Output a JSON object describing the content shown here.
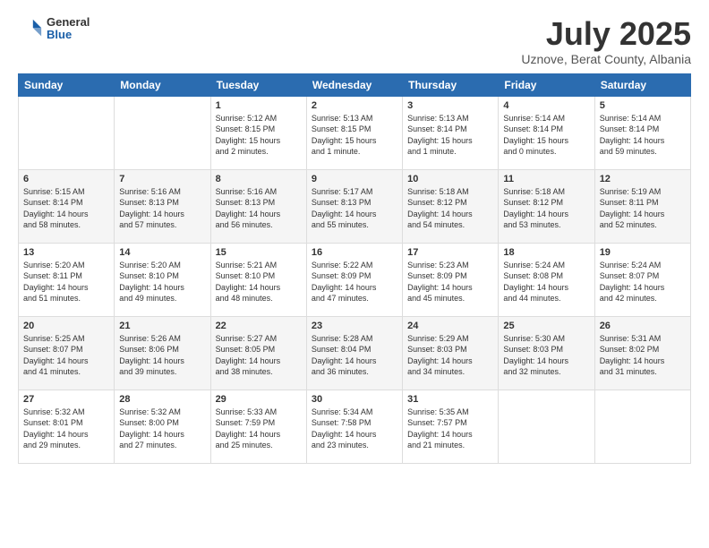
{
  "logo": {
    "general": "General",
    "blue": "Blue"
  },
  "header": {
    "month": "July 2025",
    "location": "Uznove, Berat County, Albania"
  },
  "weekdays": [
    "Sunday",
    "Monday",
    "Tuesday",
    "Wednesday",
    "Thursday",
    "Friday",
    "Saturday"
  ],
  "weeks": [
    [
      {
        "day": "",
        "info": ""
      },
      {
        "day": "",
        "info": ""
      },
      {
        "day": "1",
        "info": "Sunrise: 5:12 AM\nSunset: 8:15 PM\nDaylight: 15 hours\nand 2 minutes."
      },
      {
        "day": "2",
        "info": "Sunrise: 5:13 AM\nSunset: 8:15 PM\nDaylight: 15 hours\nand 1 minute."
      },
      {
        "day": "3",
        "info": "Sunrise: 5:13 AM\nSunset: 8:14 PM\nDaylight: 15 hours\nand 1 minute."
      },
      {
        "day": "4",
        "info": "Sunrise: 5:14 AM\nSunset: 8:14 PM\nDaylight: 15 hours\nand 0 minutes."
      },
      {
        "day": "5",
        "info": "Sunrise: 5:14 AM\nSunset: 8:14 PM\nDaylight: 14 hours\nand 59 minutes."
      }
    ],
    [
      {
        "day": "6",
        "info": "Sunrise: 5:15 AM\nSunset: 8:14 PM\nDaylight: 14 hours\nand 58 minutes."
      },
      {
        "day": "7",
        "info": "Sunrise: 5:16 AM\nSunset: 8:13 PM\nDaylight: 14 hours\nand 57 minutes."
      },
      {
        "day": "8",
        "info": "Sunrise: 5:16 AM\nSunset: 8:13 PM\nDaylight: 14 hours\nand 56 minutes."
      },
      {
        "day": "9",
        "info": "Sunrise: 5:17 AM\nSunset: 8:13 PM\nDaylight: 14 hours\nand 55 minutes."
      },
      {
        "day": "10",
        "info": "Sunrise: 5:18 AM\nSunset: 8:12 PM\nDaylight: 14 hours\nand 54 minutes."
      },
      {
        "day": "11",
        "info": "Sunrise: 5:18 AM\nSunset: 8:12 PM\nDaylight: 14 hours\nand 53 minutes."
      },
      {
        "day": "12",
        "info": "Sunrise: 5:19 AM\nSunset: 8:11 PM\nDaylight: 14 hours\nand 52 minutes."
      }
    ],
    [
      {
        "day": "13",
        "info": "Sunrise: 5:20 AM\nSunset: 8:11 PM\nDaylight: 14 hours\nand 51 minutes."
      },
      {
        "day": "14",
        "info": "Sunrise: 5:20 AM\nSunset: 8:10 PM\nDaylight: 14 hours\nand 49 minutes."
      },
      {
        "day": "15",
        "info": "Sunrise: 5:21 AM\nSunset: 8:10 PM\nDaylight: 14 hours\nand 48 minutes."
      },
      {
        "day": "16",
        "info": "Sunrise: 5:22 AM\nSunset: 8:09 PM\nDaylight: 14 hours\nand 47 minutes."
      },
      {
        "day": "17",
        "info": "Sunrise: 5:23 AM\nSunset: 8:09 PM\nDaylight: 14 hours\nand 45 minutes."
      },
      {
        "day": "18",
        "info": "Sunrise: 5:24 AM\nSunset: 8:08 PM\nDaylight: 14 hours\nand 44 minutes."
      },
      {
        "day": "19",
        "info": "Sunrise: 5:24 AM\nSunset: 8:07 PM\nDaylight: 14 hours\nand 42 minutes."
      }
    ],
    [
      {
        "day": "20",
        "info": "Sunrise: 5:25 AM\nSunset: 8:07 PM\nDaylight: 14 hours\nand 41 minutes."
      },
      {
        "day": "21",
        "info": "Sunrise: 5:26 AM\nSunset: 8:06 PM\nDaylight: 14 hours\nand 39 minutes."
      },
      {
        "day": "22",
        "info": "Sunrise: 5:27 AM\nSunset: 8:05 PM\nDaylight: 14 hours\nand 38 minutes."
      },
      {
        "day": "23",
        "info": "Sunrise: 5:28 AM\nSunset: 8:04 PM\nDaylight: 14 hours\nand 36 minutes."
      },
      {
        "day": "24",
        "info": "Sunrise: 5:29 AM\nSunset: 8:03 PM\nDaylight: 14 hours\nand 34 minutes."
      },
      {
        "day": "25",
        "info": "Sunrise: 5:30 AM\nSunset: 8:03 PM\nDaylight: 14 hours\nand 32 minutes."
      },
      {
        "day": "26",
        "info": "Sunrise: 5:31 AM\nSunset: 8:02 PM\nDaylight: 14 hours\nand 31 minutes."
      }
    ],
    [
      {
        "day": "27",
        "info": "Sunrise: 5:32 AM\nSunset: 8:01 PM\nDaylight: 14 hours\nand 29 minutes."
      },
      {
        "day": "28",
        "info": "Sunrise: 5:32 AM\nSunset: 8:00 PM\nDaylight: 14 hours\nand 27 minutes."
      },
      {
        "day": "29",
        "info": "Sunrise: 5:33 AM\nSunset: 7:59 PM\nDaylight: 14 hours\nand 25 minutes."
      },
      {
        "day": "30",
        "info": "Sunrise: 5:34 AM\nSunset: 7:58 PM\nDaylight: 14 hours\nand 23 minutes."
      },
      {
        "day": "31",
        "info": "Sunrise: 5:35 AM\nSunset: 7:57 PM\nDaylight: 14 hours\nand 21 minutes."
      },
      {
        "day": "",
        "info": ""
      },
      {
        "day": "",
        "info": ""
      }
    ]
  ]
}
